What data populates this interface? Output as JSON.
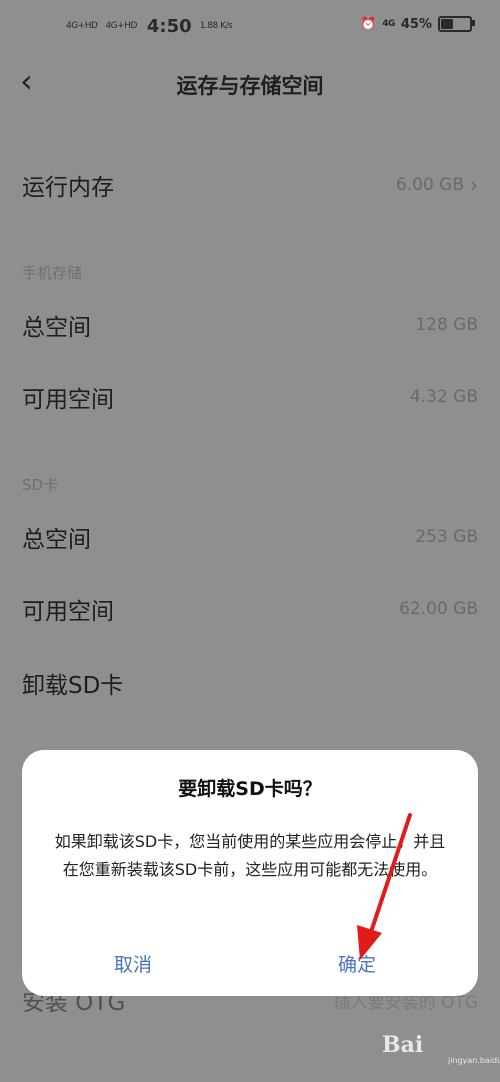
{
  "status_bar": {
    "signal1": "4G+HD",
    "signal2": "4G+HD",
    "time": "4:50",
    "speed": "1.88 K/s",
    "battery_percent": "45%",
    "icons_right": [
      "alarm-icon",
      "4g-icon",
      "battery-icon"
    ]
  },
  "header": {
    "back_icon": "back-chevron-icon",
    "title": "运存与存储空间"
  },
  "ram": {
    "label": "运行内存",
    "value": "6.00 GB"
  },
  "phone_storage": {
    "section_label": "手机存储",
    "total_label": "总空间",
    "total_value": "128 GB",
    "available_label": "可用空间",
    "available_value": "4.32 GB"
  },
  "sd_card": {
    "section_label": "SD卡",
    "total_label": "总空间",
    "total_value": "253 GB",
    "available_label": "可用空间",
    "available_value": "62.00 GB",
    "unmount_label": "卸载SD卡"
  },
  "otg": {
    "install_label": "安装 OTG",
    "install_hint": "插入要安装的 OTG"
  },
  "dialog": {
    "title": "要卸载SD卡吗？",
    "message": "如果卸载该SD卡，您当前使用的某些应用会停止，并且在您重新装载该SD卡前，这些应用可能都无法使用。",
    "cancel_label": "取消",
    "confirm_label": "确定"
  },
  "watermark": {
    "brand": "Bai",
    "site": "jingyan.baidu.com"
  },
  "colors": {
    "overlay": "#8f8f8f",
    "dialog_button": "#4a73c4",
    "arrow": "#e11a1a"
  }
}
